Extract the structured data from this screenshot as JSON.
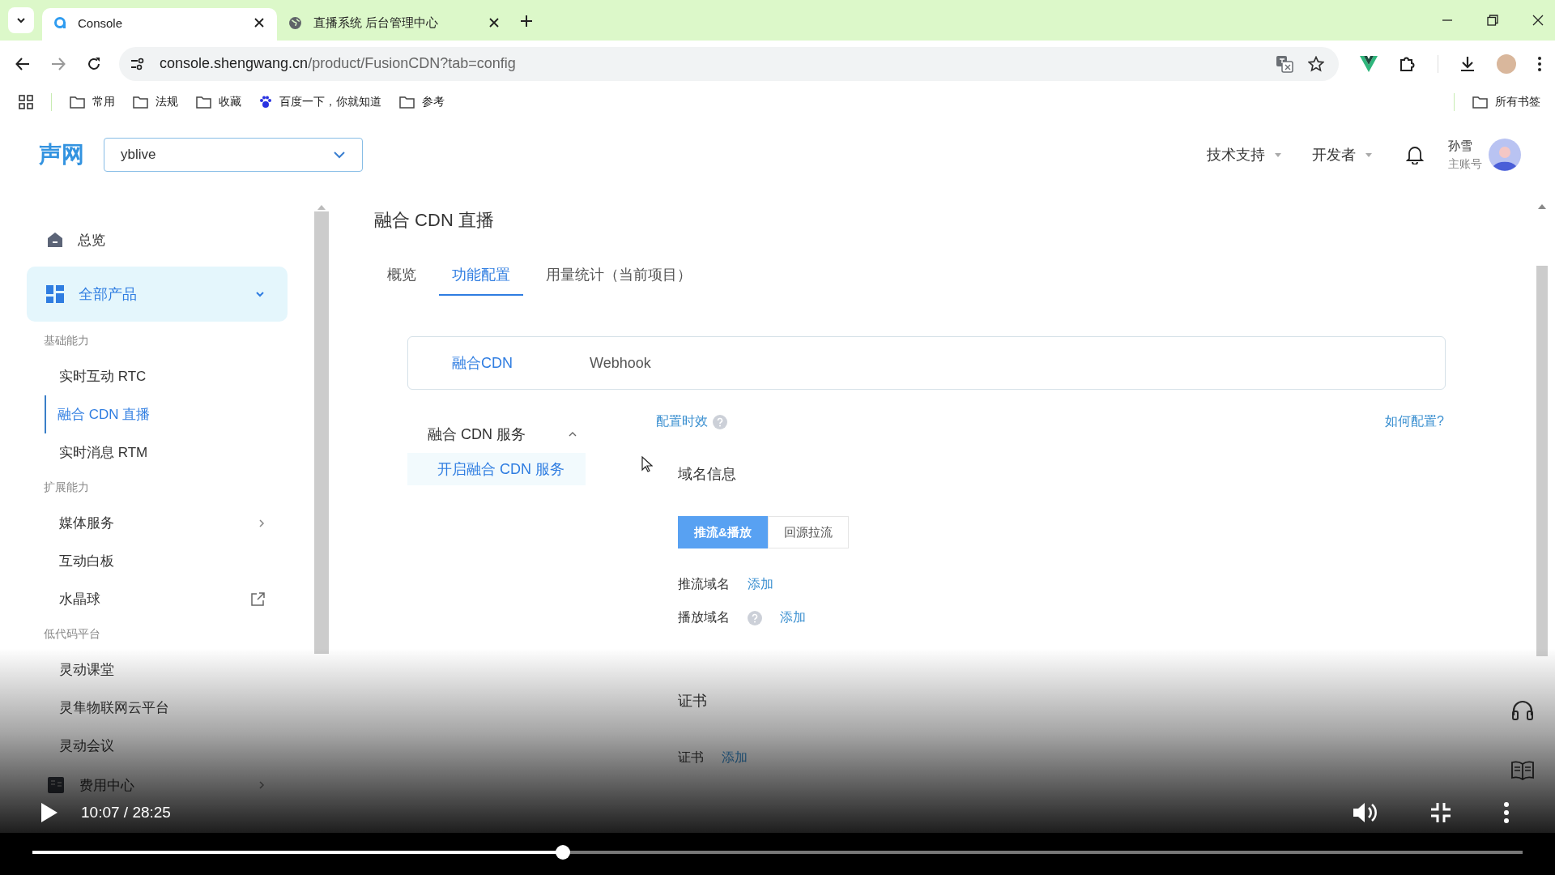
{
  "browser": {
    "tabs": [
      {
        "title": "Console",
        "selected": true
      },
      {
        "title": "直播系统 后台管理中心",
        "selected": false
      }
    ],
    "url_host": "console.shengwang.cn",
    "url_path": "/product/FusionCDN?tab=config",
    "bookmarks": [
      {
        "label": "常用",
        "kind": "folder"
      },
      {
        "label": "法规",
        "kind": "folder"
      },
      {
        "label": "收藏",
        "kind": "folder"
      },
      {
        "label": "百度一下，你就知道",
        "kind": "site"
      },
      {
        "label": "参考",
        "kind": "folder"
      }
    ],
    "all_bookmarks": "所有书签"
  },
  "header": {
    "logo": "声网",
    "project": "yblive",
    "menus": [
      "技术支持",
      "开发者"
    ],
    "user": {
      "name": "孙雪",
      "role": "主账号"
    }
  },
  "sidebar": {
    "items": [
      {
        "kind": "top",
        "label": "总览"
      },
      {
        "kind": "section",
        "label": "全部产品",
        "expanded": true
      },
      {
        "kind": "heading",
        "label": "基础能力"
      },
      {
        "kind": "link",
        "label": "实时互动 RTC",
        "selected": false
      },
      {
        "kind": "link",
        "label": "融合 CDN 直播",
        "selected": true
      },
      {
        "kind": "link",
        "label": "实时消息 RTM",
        "selected": false
      },
      {
        "kind": "heading",
        "label": "扩展能力"
      },
      {
        "kind": "submenu",
        "label": "媒体服务",
        "selected": false
      },
      {
        "kind": "link",
        "label": "互动白板",
        "selected": false
      },
      {
        "kind": "external",
        "label": "水晶球",
        "selected": false
      },
      {
        "kind": "heading",
        "label": "低代码平台"
      },
      {
        "kind": "link",
        "label": "灵动课堂",
        "selected": false
      },
      {
        "kind": "link",
        "label": "灵隼物联网云平台",
        "selected": false
      },
      {
        "kind": "link",
        "label": "灵动会议",
        "selected": false
      },
      {
        "kind": "billing",
        "label": "费用中心"
      }
    ]
  },
  "page": {
    "title": "融合 CDN 直播",
    "tabs": [
      {
        "label": "概览",
        "selected": false
      },
      {
        "label": "功能配置",
        "selected": true
      },
      {
        "label": "用量统计（当前项目）",
        "selected": false
      }
    ],
    "subtabs": [
      {
        "label": "融合CDN",
        "selected": true
      },
      {
        "label": "Webhook",
        "selected": false
      }
    ],
    "service_menu": {
      "title": "融合 CDN 服务",
      "expanded": true,
      "items": [
        {
          "label": "开启融合 CDN 服务",
          "selected": true
        }
      ]
    },
    "config_link": "配置时效",
    "help_link": "如何配置?",
    "domain_section": {
      "title": "域名信息",
      "modes": [
        {
          "label": "推流&播放",
          "selected": true
        },
        {
          "label": "回源拉流",
          "selected": false
        }
      ],
      "fields": [
        {
          "label": "推流域名",
          "help": false,
          "action": "添加"
        },
        {
          "label": "播放域名",
          "help": true,
          "action": "添加"
        }
      ]
    },
    "cert_section": {
      "title": "证书",
      "fields": [
        {
          "label": "证书",
          "help": false,
          "action": "添加"
        }
      ]
    }
  },
  "video": {
    "playing": false,
    "time": "10:07 / 28:25",
    "level": 0.356
  }
}
